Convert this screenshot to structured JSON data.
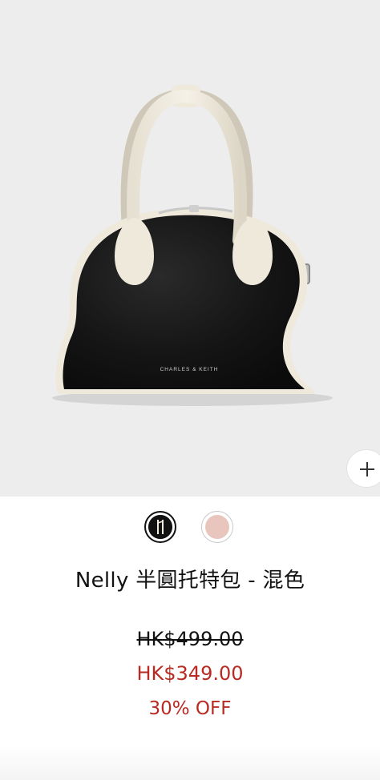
{
  "product": {
    "brand_mark": "CHARLES & KEITH",
    "name": "Nelly 半圓托特包 - 混色",
    "price_original": "HK$499.00",
    "price_sale": "HK$349.00",
    "discount": "30% OFF"
  },
  "zoom": {
    "icon": "plus-icon"
  },
  "swatches": [
    {
      "name": "black-cream",
      "color": "#111111",
      "accent": "#f2ecdf",
      "selected": true
    },
    {
      "name": "blush",
      "color": "#e9c6bd",
      "selected": false
    }
  ],
  "colors": {
    "image_bg": "#ededed",
    "bag_body": "#141414",
    "bag_trim": "#efe9dc",
    "sale_red": "#b82a22"
  }
}
